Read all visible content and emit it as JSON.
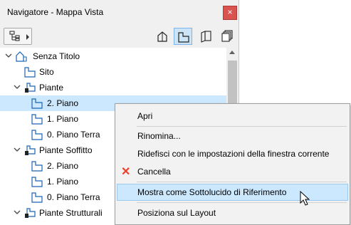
{
  "window": {
    "title": "Navigatore - Mappa Vista",
    "close": "×"
  },
  "toolbar": {
    "buttons": [
      {
        "icon": "project-map-icon",
        "active": false
      },
      {
        "icon": "view-map-icon",
        "active": true
      },
      {
        "icon": "layout-book-icon",
        "active": false
      },
      {
        "icon": "publisher-sets-icon",
        "active": false
      }
    ]
  },
  "tree": {
    "items": [
      {
        "label": "Senza Titolo",
        "icon": "project-icon",
        "expanded": true
      },
      {
        "label": "Sito",
        "icon": "floorplan-icon"
      },
      {
        "label": "Piante",
        "icon": "folder-icon",
        "expanded": true
      },
      {
        "label": "2. Piano",
        "icon": "floorplan-icon",
        "selected": true
      },
      {
        "label": "1. Piano",
        "icon": "floorplan-icon"
      },
      {
        "label": "0. Piano Terra",
        "icon": "floorplan-icon"
      },
      {
        "label": "Piante Soffitto",
        "icon": "folder-icon",
        "expanded": true
      },
      {
        "label": "2. Piano",
        "icon": "floorplan-icon"
      },
      {
        "label": "1. Piano",
        "icon": "floorplan-icon"
      },
      {
        "label": "0. Piano Terra",
        "icon": "floorplan-icon"
      },
      {
        "label": "Piante Strutturali",
        "icon": "folder-icon",
        "expanded": true
      }
    ]
  },
  "context_menu": {
    "items": [
      {
        "label": "Apri"
      },
      {
        "label": "Rinomina..."
      },
      {
        "label": "Ridefisci con le impostazioni della finestra corrente"
      },
      {
        "label": "Cancella",
        "icon": "delete-x-icon"
      },
      {
        "label": "Mostra come Sottolucido di Riferimento",
        "highlighted": true
      },
      {
        "label": "Posiziona sul Layout"
      }
    ]
  },
  "colors": {
    "selection": "#cce8ff",
    "selection_border": "#99c9f0",
    "accent_blue": "#1a64b4",
    "close_red": "#d9534f",
    "delete_red": "#e8412c"
  }
}
